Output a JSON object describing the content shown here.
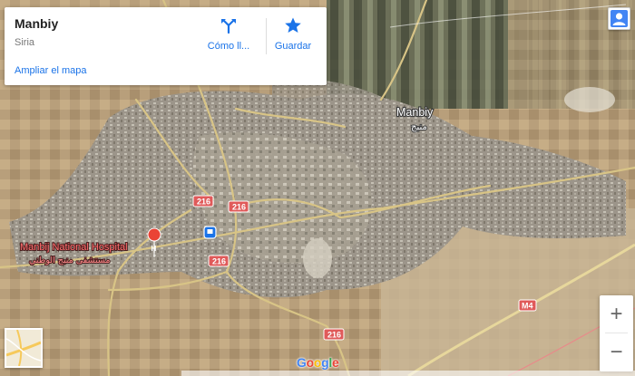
{
  "place_card": {
    "title": "Manbiy",
    "subtitle": "Siria",
    "enlarge_link": "Ampliar el mapa",
    "directions_label": "Cómo ll...",
    "save_label": "Guardar"
  },
  "map": {
    "city_label": "Manbiy",
    "city_label_arabic": "منبج",
    "poi_label": "Manbij National Hospital",
    "poi_label_arabic": "مستشفى منبج الوطني",
    "road_shields": [
      "216",
      "216",
      "216",
      "216",
      "M4"
    ],
    "attribution_logo": "Google"
  },
  "controls": {
    "zoom_in": "+",
    "zoom_out": "−"
  },
  "colors": {
    "link_blue": "#1a73e8",
    "road_shield_red": "#e05a5a",
    "poi_red": "#ea4335",
    "transit_blue": "#1a73e8"
  },
  "icons": {
    "directions": "directions-icon",
    "save": "star-icon",
    "account": "avatar-icon",
    "layer": "map-thumbnail"
  }
}
